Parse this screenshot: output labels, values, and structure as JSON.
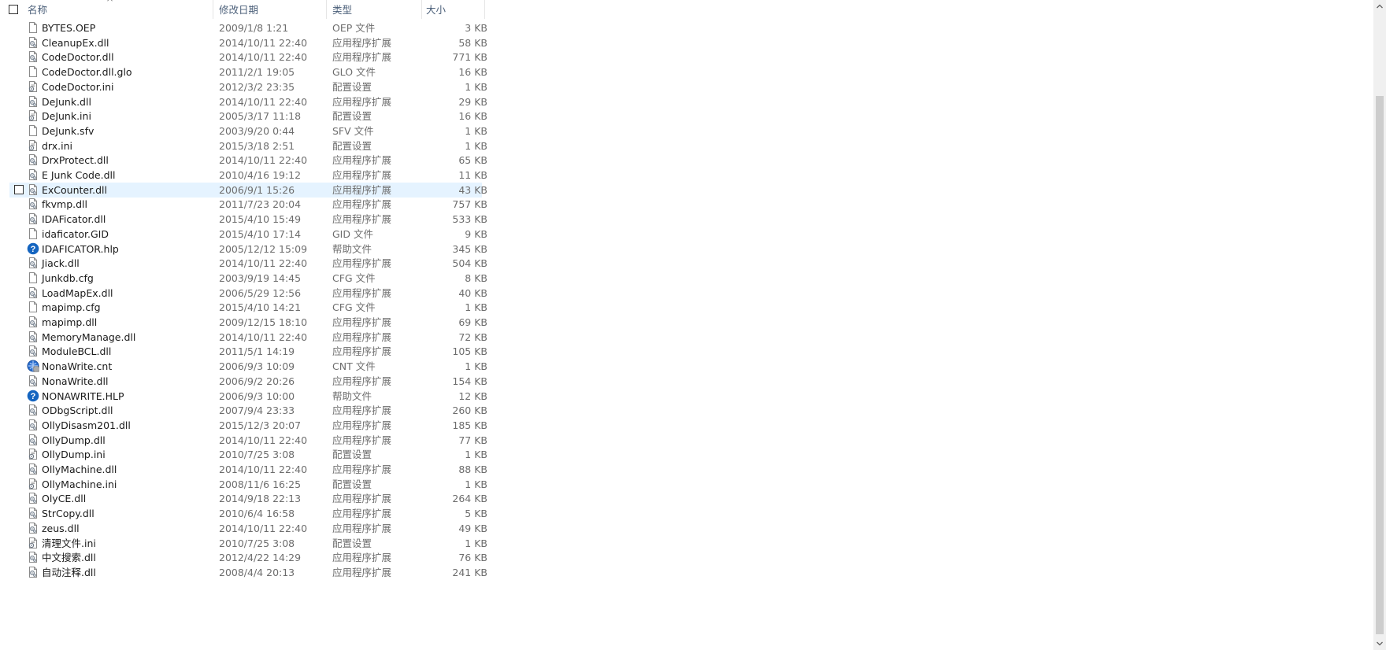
{
  "header": {
    "name_label": "名称",
    "date_label": "修改日期",
    "type_label": "类型",
    "size_label": "大小"
  },
  "files": [
    {
      "name": "BYTES.OEP",
      "date": "2009/1/8 1:21",
      "type": "OEP 文件",
      "size": "3 KB",
      "icon": "blank-file-icon"
    },
    {
      "name": "CleanupEx.dll",
      "date": "2014/10/11 22:40",
      "type": "应用程序扩展",
      "size": "58 KB",
      "icon": "dll-file-icon"
    },
    {
      "name": "CodeDoctor.dll",
      "date": "2014/10/11 22:40",
      "type": "应用程序扩展",
      "size": "771 KB",
      "icon": "dll-file-icon"
    },
    {
      "name": "CodeDoctor.dll.glo",
      "date": "2011/2/1 19:05",
      "type": "GLO 文件",
      "size": "16 KB",
      "icon": "blank-file-icon"
    },
    {
      "name": "CodeDoctor.ini",
      "date": "2012/3/2 23:35",
      "type": "配置设置",
      "size": "1 KB",
      "icon": "ini-file-icon"
    },
    {
      "name": "DeJunk.dll",
      "date": "2014/10/11 22:40",
      "type": "应用程序扩展",
      "size": "29 KB",
      "icon": "dll-file-icon"
    },
    {
      "name": "DeJunk.ini",
      "date": "2005/3/17 11:18",
      "type": "配置设置",
      "size": "16 KB",
      "icon": "ini-file-icon"
    },
    {
      "name": "DeJunk.sfv",
      "date": "2003/9/20 0:44",
      "type": "SFV 文件",
      "size": "1 KB",
      "icon": "blank-file-icon"
    },
    {
      "name": "drx.ini",
      "date": "2015/3/18 2:51",
      "type": "配置设置",
      "size": "1 KB",
      "icon": "ini-file-icon"
    },
    {
      "name": "DrxProtect.dll",
      "date": "2014/10/11 22:40",
      "type": "应用程序扩展",
      "size": "65 KB",
      "icon": "dll-file-icon"
    },
    {
      "name": "E Junk Code.dll",
      "date": "2010/4/16 19:12",
      "type": "应用程序扩展",
      "size": "11 KB",
      "icon": "dll-file-icon"
    },
    {
      "name": "ExCounter.dll",
      "date": "2006/9/1 15:26",
      "type": "应用程序扩展",
      "size": "43 KB",
      "icon": "dll-file-icon",
      "hover": true
    },
    {
      "name": "fkvmp.dll",
      "date": "2011/7/23 20:04",
      "type": "应用程序扩展",
      "size": "757 KB",
      "icon": "dll-file-icon"
    },
    {
      "name": "IDAFicator.dll",
      "date": "2015/4/10 15:49",
      "type": "应用程序扩展",
      "size": "533 KB",
      "icon": "dll-file-icon"
    },
    {
      "name": "idaficator.GID",
      "date": "2015/4/10 17:14",
      "type": "GID 文件",
      "size": "9 KB",
      "icon": "blank-file-icon"
    },
    {
      "name": "IDAFICATOR.hlp",
      "date": "2005/12/12 15:09",
      "type": "帮助文件",
      "size": "345 KB",
      "icon": "help-file-icon"
    },
    {
      "name": "Jiack.dll",
      "date": "2014/10/11 22:40",
      "type": "应用程序扩展",
      "size": "504 KB",
      "icon": "dll-file-icon"
    },
    {
      "name": "Junkdb.cfg",
      "date": "2003/9/19 14:45",
      "type": "CFG 文件",
      "size": "8 KB",
      "icon": "blank-file-icon"
    },
    {
      "name": "LoadMapEx.dll",
      "date": "2006/5/29 12:56",
      "type": "应用程序扩展",
      "size": "40 KB",
      "icon": "dll-file-icon"
    },
    {
      "name": "mapimp.cfg",
      "date": "2015/4/10 14:21",
      "type": "CFG 文件",
      "size": "1 KB",
      "icon": "blank-file-icon"
    },
    {
      "name": "mapimp.dll",
      "date": "2009/12/15 18:10",
      "type": "应用程序扩展",
      "size": "69 KB",
      "icon": "dll-file-icon"
    },
    {
      "name": "MemoryManage.dll",
      "date": "2014/10/11 22:40",
      "type": "应用程序扩展",
      "size": "72 KB",
      "icon": "dll-file-icon"
    },
    {
      "name": "ModuleBCL.dll",
      "date": "2011/5/1 14:19",
      "type": "应用程序扩展",
      "size": "105 KB",
      "icon": "dll-file-icon"
    },
    {
      "name": "NonaWrite.cnt",
      "date": "2006/9/3 10:09",
      "type": "CNT 文件",
      "size": "1 KB",
      "icon": "cnt-file-icon"
    },
    {
      "name": "NonaWrite.dll",
      "date": "2006/9/2 20:26",
      "type": "应用程序扩展",
      "size": "154 KB",
      "icon": "dll-file-icon"
    },
    {
      "name": "NONAWRITE.HLP",
      "date": "2006/9/3 10:00",
      "type": "帮助文件",
      "size": "12 KB",
      "icon": "help-file-icon"
    },
    {
      "name": "ODbgScript.dll",
      "date": "2007/9/4 23:33",
      "type": "应用程序扩展",
      "size": "260 KB",
      "icon": "dll-file-icon"
    },
    {
      "name": "OllyDisasm201.dll",
      "date": "2015/12/3 20:07",
      "type": "应用程序扩展",
      "size": "185 KB",
      "icon": "dll-file-icon"
    },
    {
      "name": "OllyDump.dll",
      "date": "2014/10/11 22:40",
      "type": "应用程序扩展",
      "size": "77 KB",
      "icon": "dll-file-icon"
    },
    {
      "name": "OllyDump.ini",
      "date": "2010/7/25 3:08",
      "type": "配置设置",
      "size": "1 KB",
      "icon": "ini-file-icon"
    },
    {
      "name": "OllyMachine.dll",
      "date": "2014/10/11 22:40",
      "type": "应用程序扩展",
      "size": "88 KB",
      "icon": "dll-file-icon"
    },
    {
      "name": "OllyMachine.ini",
      "date": "2008/11/6 16:25",
      "type": "配置设置",
      "size": "1 KB",
      "icon": "ini-file-icon"
    },
    {
      "name": "OlyCE.dll",
      "date": "2014/9/18 22:13",
      "type": "应用程序扩展",
      "size": "264 KB",
      "icon": "dll-file-icon"
    },
    {
      "name": "StrCopy.dll",
      "date": "2010/6/4 16:58",
      "type": "应用程序扩展",
      "size": "5 KB",
      "icon": "dll-file-icon"
    },
    {
      "name": "zeus.dll",
      "date": "2014/10/11 22:40",
      "type": "应用程序扩展",
      "size": "49 KB",
      "icon": "dll-file-icon"
    },
    {
      "name": "清理文件.ini",
      "date": "2010/7/25 3:08",
      "type": "配置设置",
      "size": "1 KB",
      "icon": "ini-file-icon"
    },
    {
      "name": "中文搜索.dll",
      "date": "2012/4/22 14:29",
      "type": "应用程序扩展",
      "size": "76 KB",
      "icon": "dll-file-icon"
    },
    {
      "name": "自动注释.dll",
      "date": "2008/4/4 20:13",
      "type": "应用程序扩展",
      "size": "241 KB",
      "icon": "dll-file-icon"
    }
  ]
}
